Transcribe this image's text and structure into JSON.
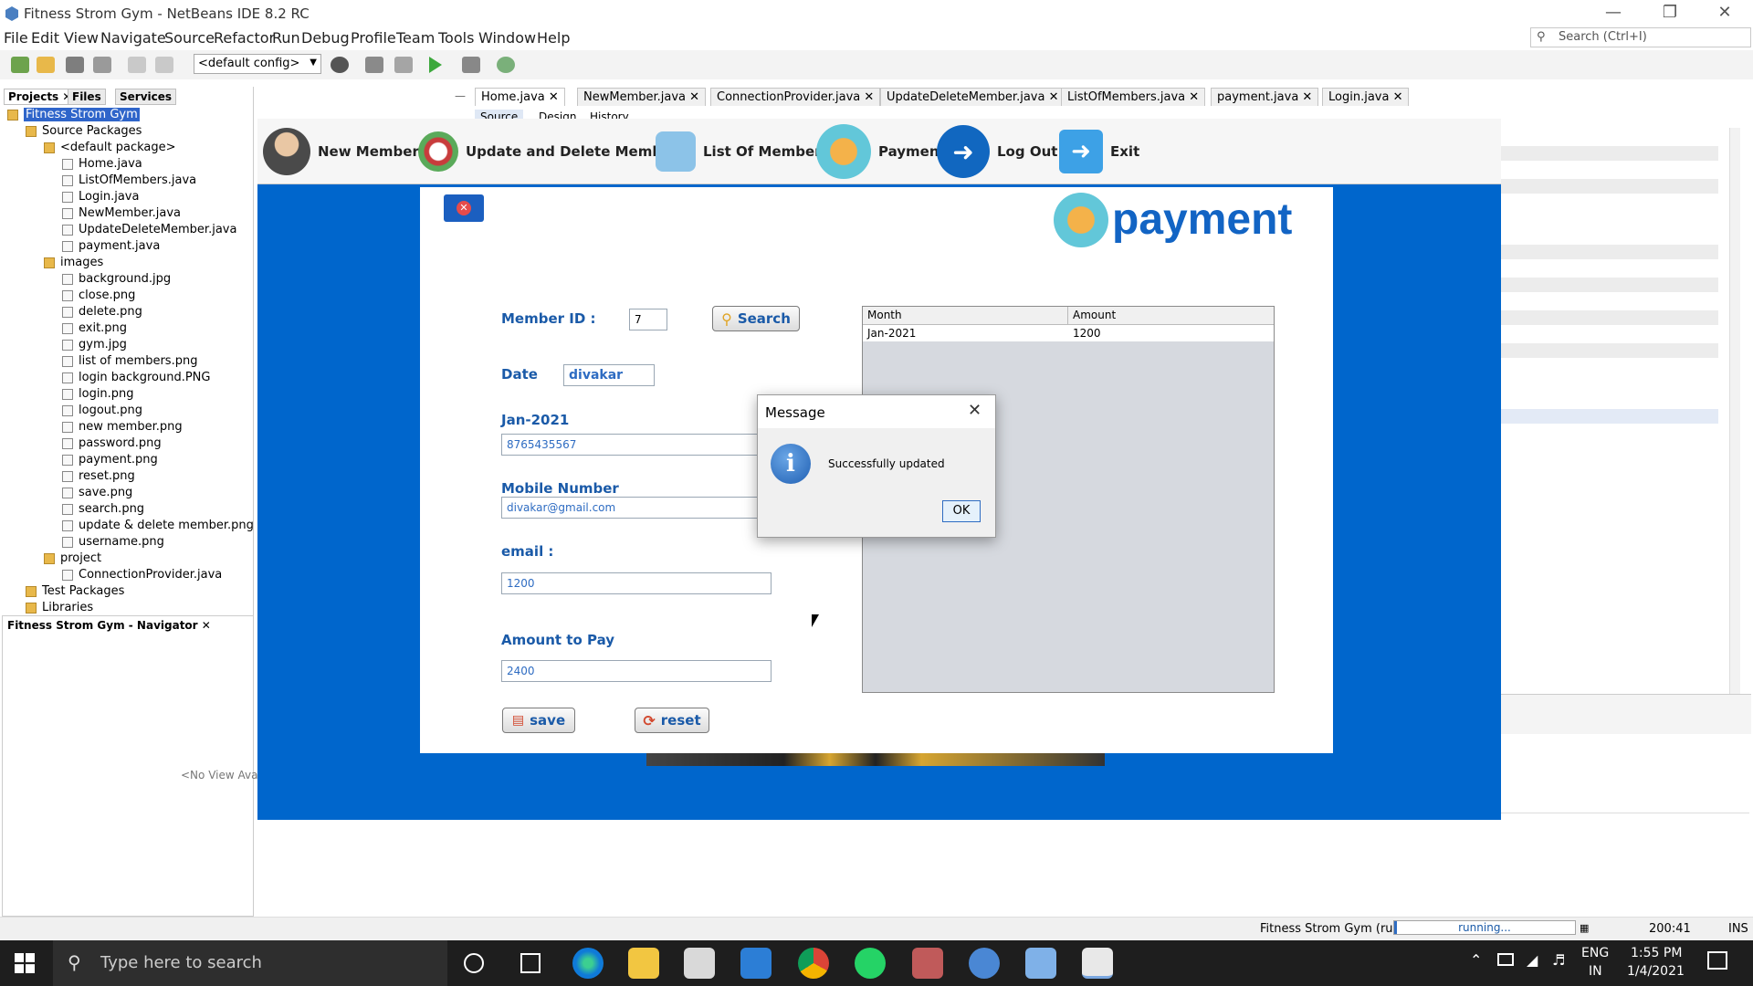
{
  "window": {
    "title": "Fitness Strom Gym - NetBeans IDE 8.2 RC"
  },
  "menus": [
    "File",
    "Edit",
    "View",
    "Navigate",
    "Source",
    "Refactor",
    "Run",
    "Debug",
    "Profile",
    "Team",
    "Tools",
    "Window",
    "Help"
  ],
  "search": {
    "placeholder": "Search (Ctrl+I)"
  },
  "toolbar": {
    "config": "<default config>"
  },
  "panel_tabs": {
    "projects": "Projects",
    "files": "Files",
    "services": "Services"
  },
  "tree": [
    {
      "label": "Fitness Strom Gym",
      "depth": 0,
      "kind": "project",
      "selected": true
    },
    {
      "label": "Source Packages",
      "depth": 1,
      "kind": "pkg"
    },
    {
      "label": "<default package>",
      "depth": 2,
      "kind": "pkg"
    },
    {
      "label": "Home.java",
      "depth": 3,
      "kind": "file"
    },
    {
      "label": "ListOfMembers.java",
      "depth": 3,
      "kind": "file"
    },
    {
      "label": "Login.java",
      "depth": 3,
      "kind": "file"
    },
    {
      "label": "NewMember.java",
      "depth": 3,
      "kind": "file"
    },
    {
      "label": "UpdateDeleteMember.java",
      "depth": 3,
      "kind": "file"
    },
    {
      "label": "payment.java",
      "depth": 3,
      "kind": "file"
    },
    {
      "label": "images",
      "depth": 2,
      "kind": "pkg"
    },
    {
      "label": "background.jpg",
      "depth": 3,
      "kind": "file"
    },
    {
      "label": "close.png",
      "depth": 3,
      "kind": "file"
    },
    {
      "label": "delete.png",
      "depth": 3,
      "kind": "file"
    },
    {
      "label": "exit.png",
      "depth": 3,
      "kind": "file"
    },
    {
      "label": "gym.jpg",
      "depth": 3,
      "kind": "file"
    },
    {
      "label": "list of members.png",
      "depth": 3,
      "kind": "file"
    },
    {
      "label": "login background.PNG",
      "depth": 3,
      "kind": "file"
    },
    {
      "label": "login.png",
      "depth": 3,
      "kind": "file"
    },
    {
      "label": "logout.png",
      "depth": 3,
      "kind": "file"
    },
    {
      "label": "new member.png",
      "depth": 3,
      "kind": "file"
    },
    {
      "label": "password.png",
      "depth": 3,
      "kind": "file"
    },
    {
      "label": "payment.png",
      "depth": 3,
      "kind": "file"
    },
    {
      "label": "reset.png",
      "depth": 3,
      "kind": "file"
    },
    {
      "label": "save.png",
      "depth": 3,
      "kind": "file"
    },
    {
      "label": "search.png",
      "depth": 3,
      "kind": "file"
    },
    {
      "label": "update & delete member.png",
      "depth": 3,
      "kind": "file"
    },
    {
      "label": "username.png",
      "depth": 3,
      "kind": "file"
    },
    {
      "label": "project",
      "depth": 2,
      "kind": "pkg"
    },
    {
      "label": "ConnectionProvider.java",
      "depth": 3,
      "kind": "file"
    },
    {
      "label": "Test Packages",
      "depth": 1,
      "kind": "pkg"
    },
    {
      "label": "Libraries",
      "depth": 1,
      "kind": "pkg"
    }
  ],
  "navigator": {
    "title": "Fitness Strom Gym - Navigator",
    "empty": "<No View Ava"
  },
  "editor_tabs": [
    "Home.java",
    "NewMember.java",
    "ConnectionProvider.java",
    "UpdateDeleteMember.java",
    "ListOfMembers.java",
    "payment.java",
    "Login.java"
  ],
  "editor_subtabs": [
    "Source",
    "Design",
    "History"
  ],
  "app": {
    "nav": [
      "New Member",
      "Update and Delete Member",
      "List Of Members",
      "Payment",
      "Log Out",
      "Exit"
    ],
    "heading": "payment",
    "member_id_label": "Member ID :",
    "member_id_value": "7",
    "search_button": "Search",
    "date_label": "Date",
    "date_value": "divakar",
    "month_label": "Jan-2021",
    "field1_value": "8765435567",
    "mobile_label": "Mobile Number",
    "field2_value": "divakar@gmail.com",
    "email_label": "email :",
    "field3_value": "1200",
    "amount_label": "Amount to Pay",
    "amount_value": "2400",
    "save_button": "save",
    "reset_button": "reset",
    "table": {
      "columns": [
        "Month",
        "Amount"
      ],
      "rows": [
        [
          "Jan-2021",
          "1200"
        ]
      ]
    }
  },
  "dialog": {
    "title": "Message",
    "text": "Successfully updated",
    "ok": "OK"
  },
  "status": {
    "project": "Fitness Strom Gym (run)",
    "progress_text": "running...",
    "position": "200:41",
    "mode": "INS"
  },
  "taskbar": {
    "search_placeholder": "Type here to search",
    "lang": "ENG",
    "region": "IN",
    "time": "1:55 PM",
    "date": "1/4/2021"
  }
}
